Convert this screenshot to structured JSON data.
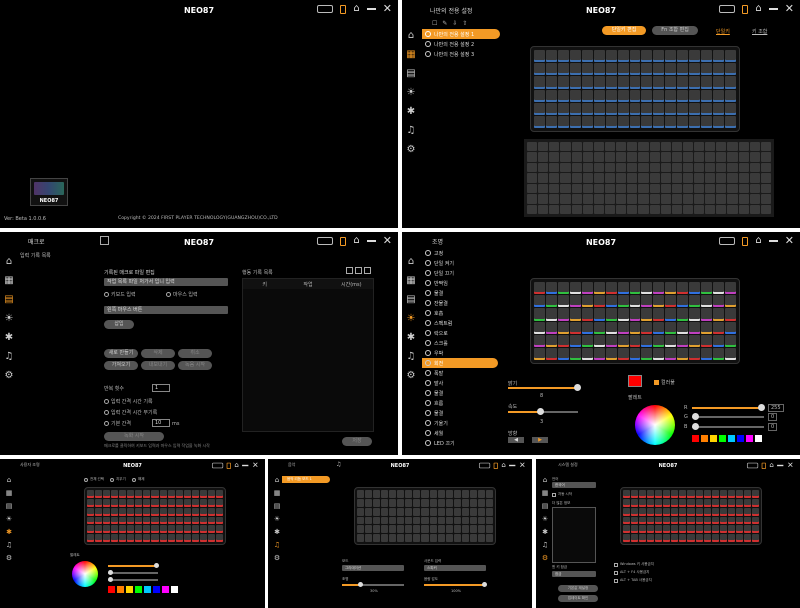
{
  "app_title": "NEO87",
  "panel1": {
    "version": "Ver: Beta 1.0.0.6",
    "copyright": "Copyright © 2024 FIRST PLAYER TECHNOLOGY(GUANGZHOU)CO.,LTD",
    "device_name": "NEO87"
  },
  "panel2": {
    "header": "나만의 전용 설정",
    "profiles": [
      "나만의 전용 설정 1",
      "나만의 전용 설정 2",
      "나만의 전용 설정 3"
    ],
    "tab_single": "단일키 편집",
    "tab_fn": "Fn 조합 편집",
    "link_single": "단일키",
    "link_combo": "키 조합"
  },
  "panel3": {
    "header": "매크로",
    "left_title": "입력 기록 목록",
    "section_title": "기록된 매크로 파일 편집",
    "macro_name_placeholder": "작업 목록 파일 처가서 입니 입력",
    "radio_keyboard": "키보드 입력",
    "radio_mouse": "마우스 입력",
    "mouse_select": "왼쪽 마우스 버튼",
    "btn_insert": "삽입",
    "btn_new": "새로 만들기",
    "btn_delete": "삭제",
    "btn_cancel_rec": "취소",
    "btn_import": "가져오기",
    "btn_export": "내보내기",
    "btn_stop": "녹음 시작",
    "right_title": "행동 기록 목록",
    "col_key": "키",
    "col_action": "작업",
    "col_time": "시간(ms)",
    "repeat_label": "반복 횟수",
    "repeat_value": "1",
    "opt_1": "입력 간격 시간 기록",
    "opt_2": "입력 간격 시간 무기록",
    "opt_3": "기본 간격",
    "interval_value": "10",
    "interval_unit": "ms",
    "btn_record": "녹화 시작",
    "hint": "매크로를 클릭하여 키보드 입력과 마우스 입력 작업을 녹화 시작",
    "btn_save": "저장"
  },
  "panel4": {
    "header": "조명",
    "effects": [
      "고정",
      "단일 켜기",
      "단일 끄기",
      "반짝임",
      "물결",
      "잔물결",
      "호흡",
      "스펙트럼",
      "락으로",
      "스크롤",
      "우박",
      "회전",
      "폭발",
      "발사",
      "물결",
      "흐름",
      "물결",
      "기울기",
      "세월",
      "LED 끄기"
    ],
    "selected_effect": 11,
    "brightness_label": "밝기",
    "brightness_value": "8",
    "speed_label": "속도",
    "speed_value": "3",
    "direction_label": "방향",
    "colorful_label": "컬러풀",
    "palette_label": "팔레트",
    "r_label": "R",
    "g_label": "G",
    "b_label": "B",
    "r_value": "255",
    "g_value": "0",
    "b_value": "0",
    "swatch_colors": [
      "#ff0000",
      "#ff7f00",
      "#ffd400",
      "#00ff00",
      "#00c8ff",
      "#0000ff",
      "#ff00ff",
      "#ffffff"
    ]
  },
  "panel5": {
    "header": "사용자 조명",
    "opt_a": "전체 선택",
    "opt_b": "지우기",
    "opt_c": "해제",
    "palette_label": "팔레트",
    "swatch_colors": [
      "#ff0000",
      "#ff7f00",
      "#ffd400",
      "#00ff00",
      "#00c8ff",
      "#0000ff",
      "#ff00ff",
      "#ffffff"
    ]
  },
  "panel6": {
    "header": "음악",
    "selected_item": "음악 리듬 모드 1",
    "mode_label": "모드",
    "mode_value": "그라데이션",
    "source_label": "사운드 입력",
    "source_value": "스피커",
    "light_label": "조명",
    "sens_label": "음량 감도",
    "light_pct": "30%",
    "sens_pct": "100%"
  },
  "panel7": {
    "header": "시스템 설정",
    "lang_label": "언어",
    "lang_value": "한국어",
    "auto_label": "자동 시작",
    "info_label": "더 많은 정보",
    "win_label": "윈 키 잠금",
    "win_value": "잠금",
    "opt_1": "Windows 키 사용금지",
    "opt_2": "ALT + F4 사용금지",
    "opt_3": "ALT + TAB 사용금지",
    "btn_reset": "기본값 재설정",
    "btn_update": "업데이트 확인"
  }
}
